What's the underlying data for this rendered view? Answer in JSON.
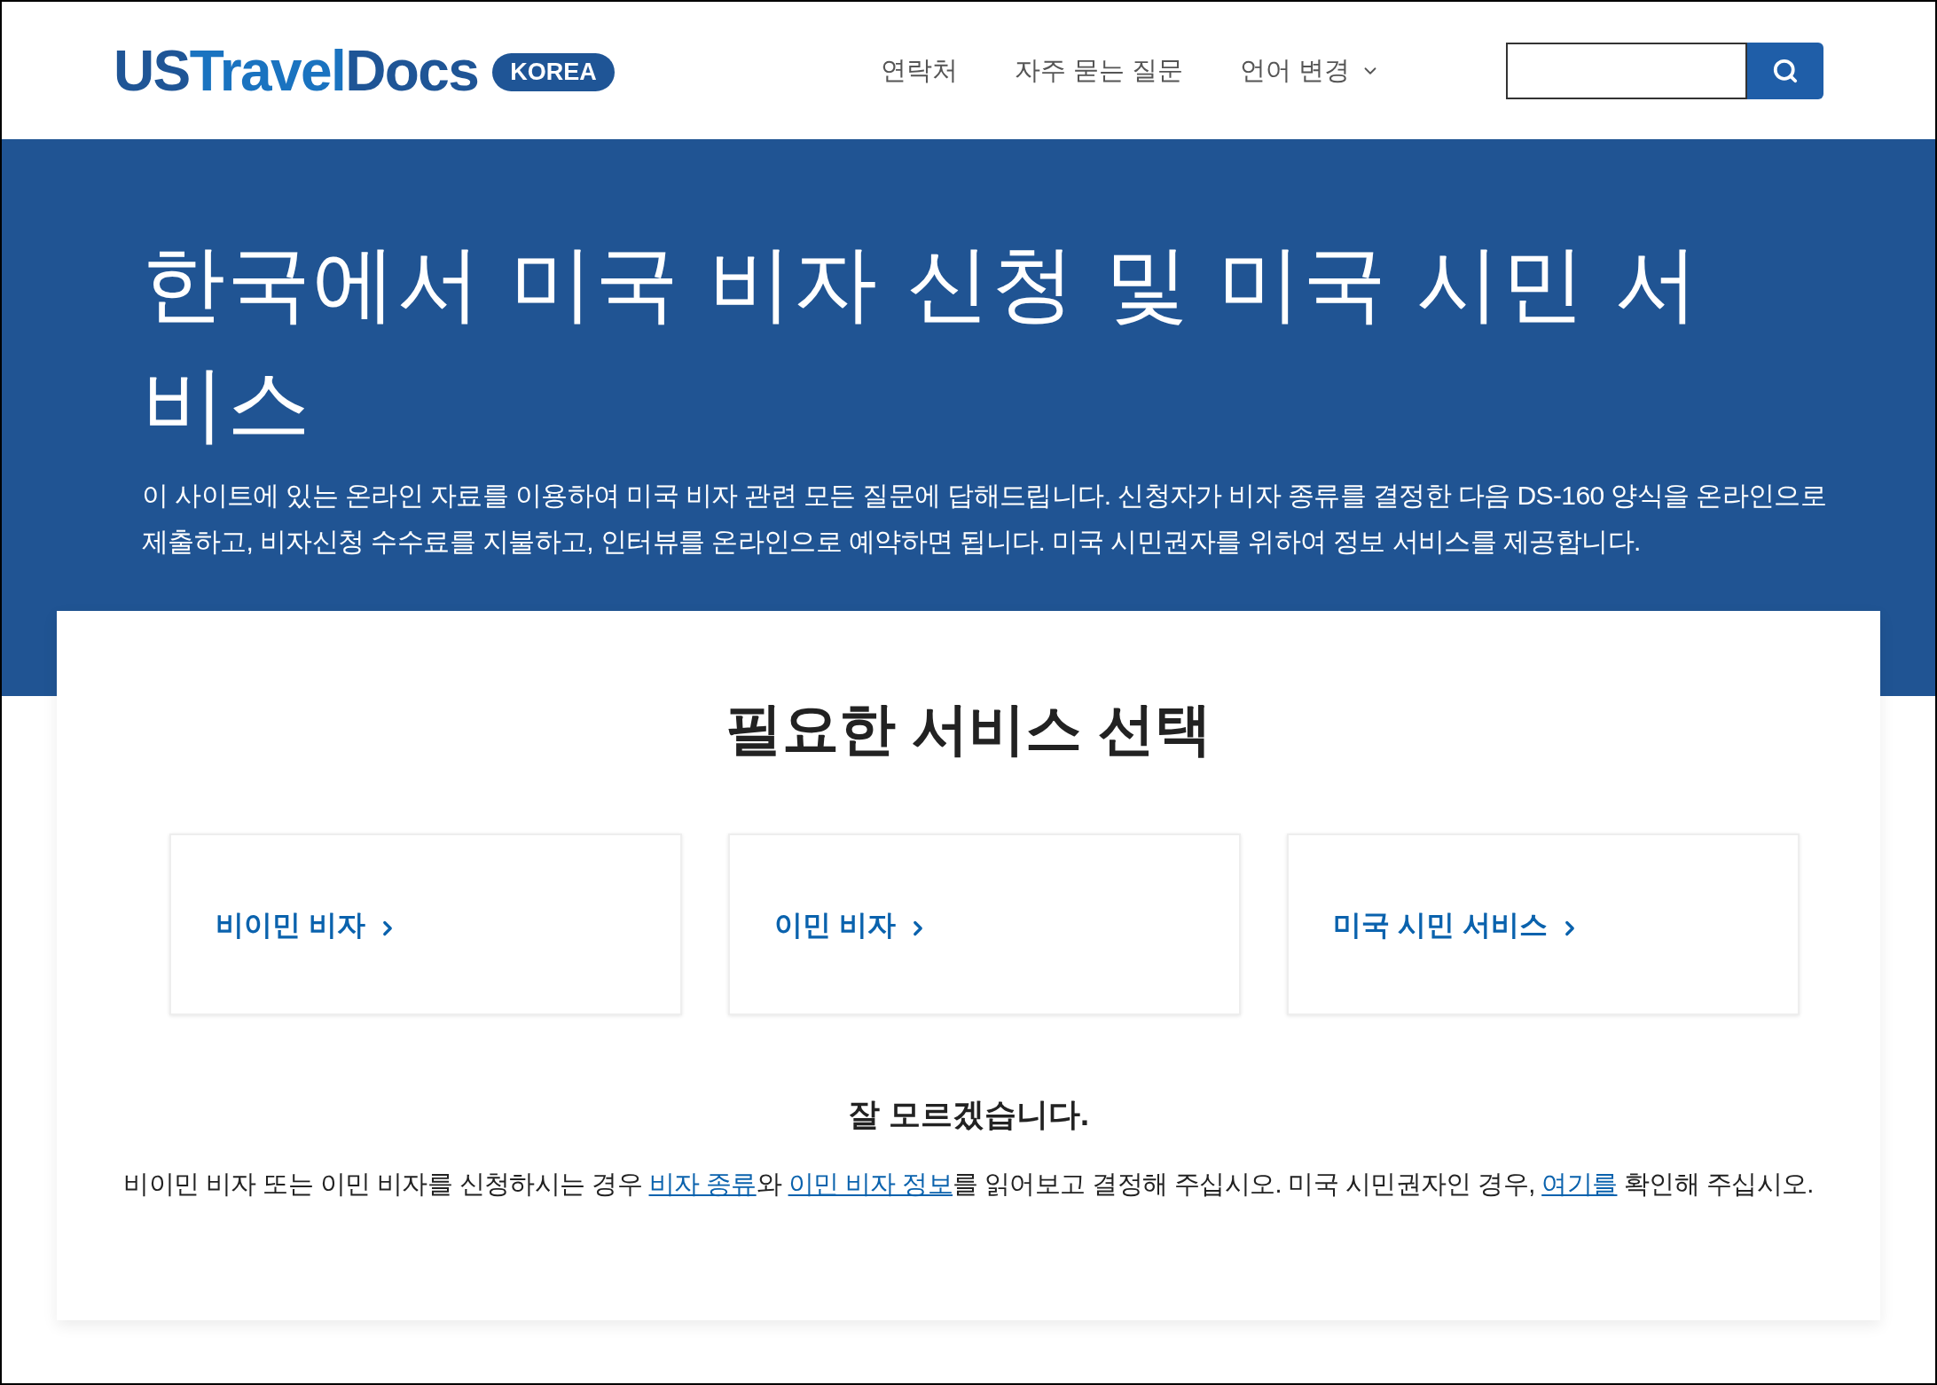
{
  "header": {
    "logo": {
      "parts": [
        {
          "text": "US",
          "color": "#1f5596"
        },
        {
          "text": "Travel",
          "color": "#1a73c0"
        },
        {
          "text": "Docs",
          "color": "#1f5596"
        }
      ],
      "badge": "KOREA"
    },
    "nav": [
      {
        "label": "연락처",
        "kind": "link"
      },
      {
        "label": "자주 묻는 질문",
        "kind": "link"
      },
      {
        "label": "언어 변경",
        "kind": "dropdown"
      }
    ]
  },
  "hero": {
    "title": "한국에서 미국 비자 신청 및 미국 시민 서비스",
    "text": "이 사이트에 있는 온라인 자료를 이용하여 미국 비자 관련 모든 질문에 답해드립니다. 신청자가 비자 종류를 결정한 다음 DS-160 양식을 온라인으로 제출하고, 비자신청 수수료를 지불하고, 인터뷰를 온라인으로 예약하면 됩니다. 미국 시민권자를 위하여 정보 서비스를 제공합니다."
  },
  "services": {
    "title": "필요한 서비스 선택",
    "cards": [
      {
        "label": "비이민 비자"
      },
      {
        "label": "이민 비자"
      },
      {
        "label": "미국 시민 서비스"
      }
    ]
  },
  "help": {
    "title": "잘 모르겠습니다.",
    "segments": [
      {
        "kind": "text",
        "text": "비이민 비자 또는 이민 비자를 신청하시는 경우 "
      },
      {
        "kind": "link",
        "text": "비자 종류"
      },
      {
        "kind": "text",
        "text": "와 "
      },
      {
        "kind": "link",
        "text": "이민 비자 정보"
      },
      {
        "kind": "text",
        "text": "를 읽어보고 결정해 주십시오. 미국 시민권자인 경우, "
      },
      {
        "kind": "link",
        "text": "여기를"
      },
      {
        "kind": "text",
        "text": " 확인해 주십시오."
      }
    ]
  }
}
